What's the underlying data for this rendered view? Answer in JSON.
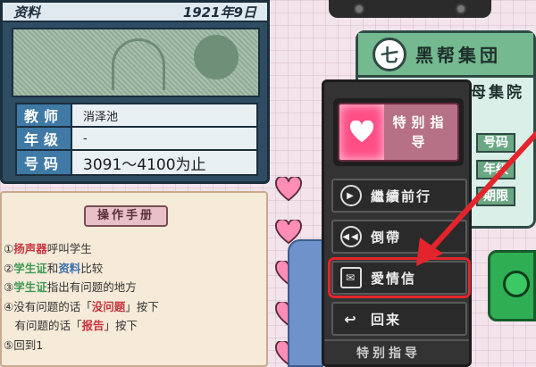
{
  "info_card": {
    "title": "资料",
    "date": "1921年9日",
    "rows": [
      {
        "key": "教师",
        "value": "消泽池"
      },
      {
        "key": "年级",
        "value": "-"
      },
      {
        "key": "号码",
        "value": "3091～4100为止"
      }
    ]
  },
  "manual": {
    "title": "操作手册",
    "items": [
      [
        {
          "t": "①"
        },
        {
          "t": "扬声器",
          "c": "red"
        },
        {
          "t": "呼叫学生"
        }
      ],
      [
        {
          "t": "②"
        },
        {
          "t": "学生证",
          "c": "green"
        },
        {
          "t": "和"
        },
        {
          "t": "资料",
          "c": "blue"
        },
        {
          "t": "比较"
        }
      ],
      [
        {
          "t": "③"
        },
        {
          "t": "学生证",
          "c": "green"
        },
        {
          "t": "指出有问题的地方"
        }
      ],
      [
        {
          "t": "④没有问题的话「"
        },
        {
          "t": "没问题",
          "c": "red"
        },
        {
          "t": "」按下"
        }
      ],
      [
        {
          "t": "　有问题的话「"
        },
        {
          "t": "报告",
          "c": "red"
        },
        {
          "t": "」按下"
        }
      ],
      [
        {
          "t": "⑤回到1"
        }
      ]
    ]
  },
  "gang_panel": {
    "logo": "七",
    "title": "黑帮集団",
    "subtitle": "母集院",
    "rows": [
      "号码",
      "年级",
      "期限"
    ]
  },
  "menu": {
    "special_label": "特别指导",
    "items": [
      {
        "label": "繼續前行",
        "icon": "play-icon"
      },
      {
        "label": "倒帶",
        "icon": "rewind-icon"
      },
      {
        "label": "愛情信",
        "icon": "love-letter-icon"
      },
      {
        "label": "回来",
        "icon": "return-arrow-icon"
      }
    ],
    "bottom_label": "特别指导"
  },
  "colors": {
    "highlight": "#e4242c",
    "menu_bg": "#333333",
    "heart": "#ff4d86"
  }
}
